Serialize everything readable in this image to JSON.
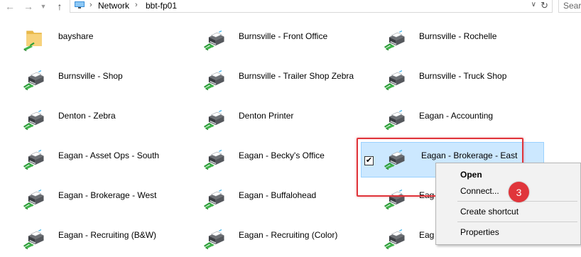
{
  "address_bar": {
    "crumbs": [
      "Network",
      "bbt-fp01"
    ],
    "search_placeholder": "Sear"
  },
  "items": [
    {
      "label": "bayshare",
      "icon": "shared-folder-icon"
    },
    {
      "label": "Burnsville - Front Office",
      "icon": "printer-icon"
    },
    {
      "label": "Burnsville - Rochelle",
      "icon": "printer-icon"
    },
    {
      "label": "Burnsville - Shop",
      "icon": "printer-icon"
    },
    {
      "label": "Burnsville - Trailer Shop Zebra",
      "icon": "printer-icon"
    },
    {
      "label": "Burnsville - Truck Shop",
      "icon": "printer-icon"
    },
    {
      "label": "Denton - Zebra",
      "icon": "printer-icon"
    },
    {
      "label": "Denton Printer",
      "icon": "printer-icon"
    },
    {
      "label": "Eagan - Accounting",
      "icon": "printer-icon"
    },
    {
      "label": "Eagan - Asset Ops - South",
      "icon": "printer-icon"
    },
    {
      "label": "Eagan - Becky's Office",
      "icon": "printer-icon"
    },
    {
      "label": "Eagan - Brokerage - East",
      "icon": "printer-icon",
      "selected": true
    },
    {
      "label": "Eagan - Brokerage - West",
      "icon": "printer-icon"
    },
    {
      "label": "Eagan - Buffalohead",
      "icon": "printer-icon"
    },
    {
      "label": "Eag",
      "icon": "printer-icon"
    },
    {
      "label": "Eagan - Recruiting (B&W)",
      "icon": "printer-icon"
    },
    {
      "label": "Eagan - Recruiting (Color)",
      "icon": "printer-icon"
    },
    {
      "label": "Eag",
      "icon": "printer-icon"
    }
  ],
  "context_menu": {
    "items": [
      "Open",
      "Connect...",
      "Create shortcut",
      "Properties"
    ]
  },
  "annotation": {
    "step_number": "3",
    "color": "#e0353b"
  },
  "colors": {
    "selection_bg": "#cce8ff",
    "selection_border": "#99d1ff"
  }
}
